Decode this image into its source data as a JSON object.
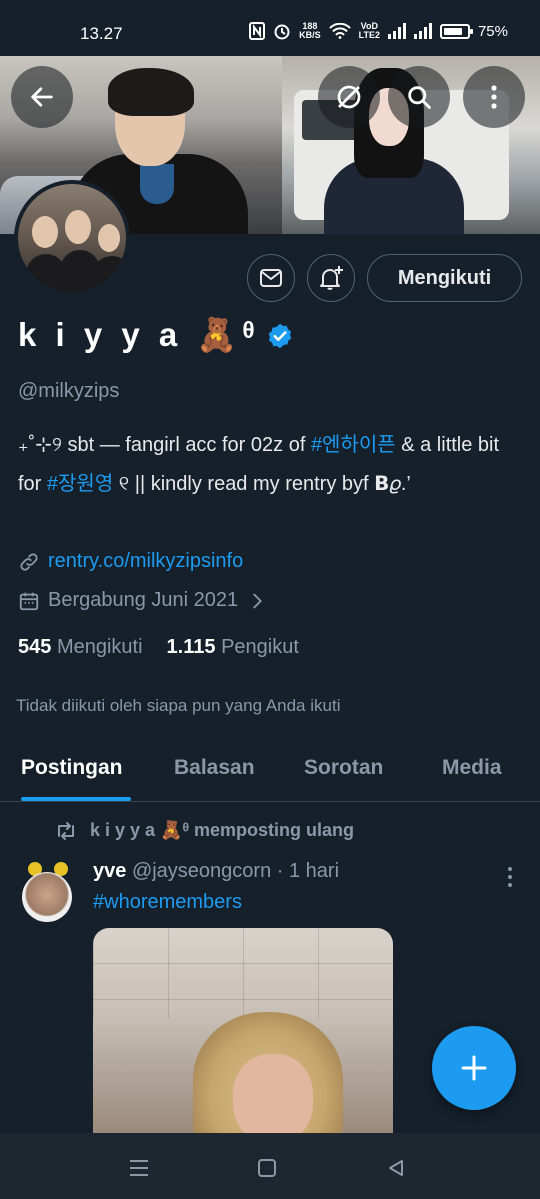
{
  "status_bar": {
    "time": "13.27",
    "speed_value": "188",
    "speed_unit": "KB/S",
    "volte_top": "VoD",
    "volte_bottom": "LTE2",
    "battery": "75%"
  },
  "profile": {
    "display_name": "k i y y a 🧸ᶿ",
    "handle": "@milkyzips",
    "bio_part1": "₊˚⊹୨ sbt — fangirl acc for 02z of ",
    "bio_tag1": "#엔하이픈",
    "bio_part2": " & a little bit for ",
    "bio_tag2": "#장원영",
    "bio_part3": " ୧ || kindly read my rentry byf 𝝗𝜚.’",
    "link": "rentry.co/milkyzipsinfo",
    "joined": "Bergabung Juni 2021",
    "following_count": "545",
    "following_label": "Mengikuti",
    "followers_count": "1.115",
    "followers_label": "Pengikut",
    "followed_note": "Tidak diikuti oleh siapa pun yang Anda ikuti",
    "follow_button": "Mengikuti"
  },
  "tabs": [
    {
      "label": "Postingan",
      "active": true
    },
    {
      "label": "Balasan",
      "active": false
    },
    {
      "label": "Sorotan",
      "active": false
    },
    {
      "label": "Media",
      "active": false
    }
  ],
  "post": {
    "repost_label": "k i y y a 🧸ᶿ memposting ulang",
    "author_name": "yve",
    "author_handle": "@jayseongcorn",
    "time": "· 1 hari",
    "text": "#whoremembers"
  },
  "icons": {
    "back": "back-arrow-icon",
    "grok": "grok-icon",
    "search": "search-icon",
    "more": "more-vertical-icon",
    "message": "message-icon",
    "notify": "notification-add-icon",
    "verified": "verified-badge-icon",
    "link": "link-icon",
    "calendar": "calendar-icon",
    "chevron": "chevron-right-icon",
    "repost": "repost-icon",
    "compose": "plus-icon"
  },
  "colors": {
    "background": "#15202b",
    "accent": "#1d9bf0",
    "secondary_text": "#8b98a5"
  }
}
